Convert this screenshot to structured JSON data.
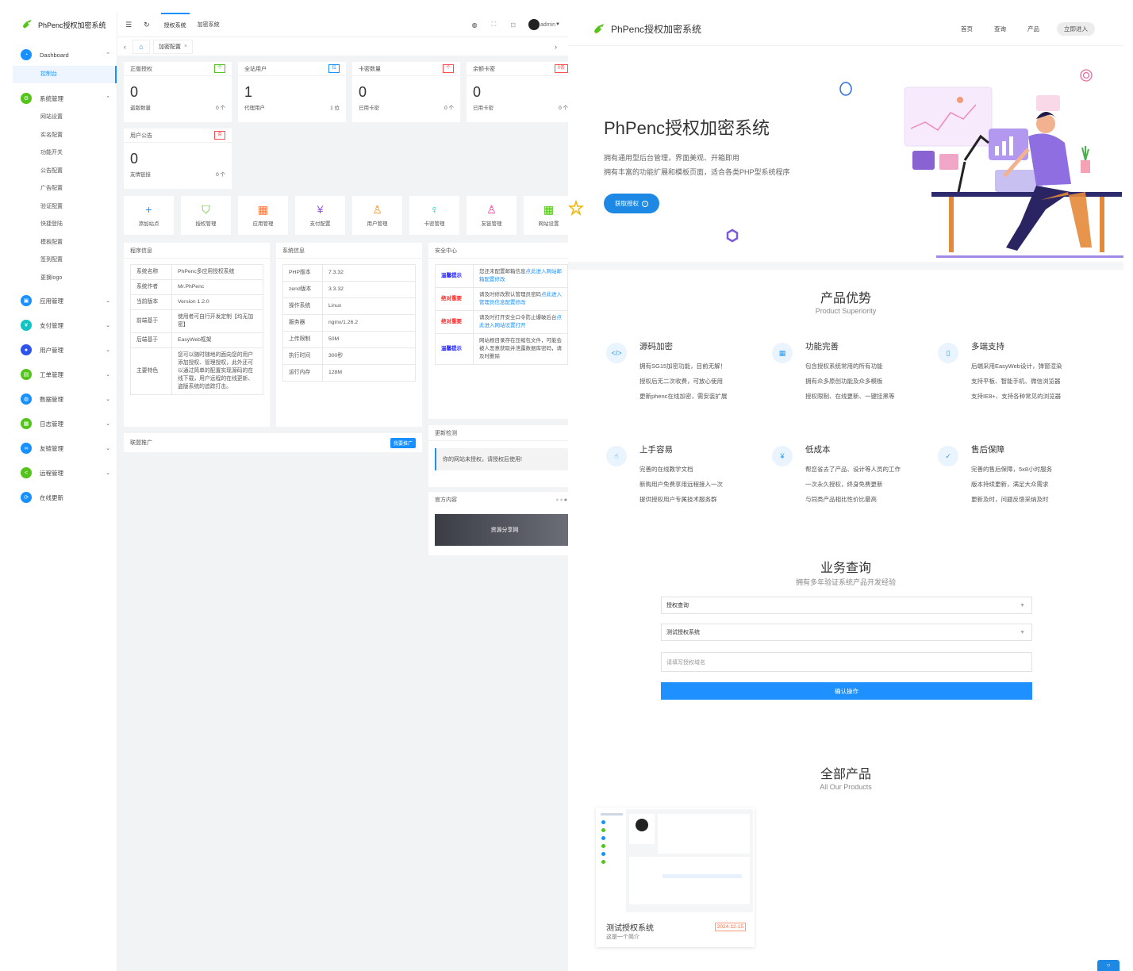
{
  "admin": {
    "brand": "PhPenc授权加密系统",
    "menu": [
      {
        "label": "Dashboard",
        "color": "#1890ff",
        "icon": "dashboard-icon",
        "glyph": "◔",
        "arrow": "⌃",
        "sub": [
          {
            "label": "控制台",
            "active": true
          }
        ]
      },
      {
        "label": "系统管理",
        "color": "#52c41a",
        "icon": "gear-icon",
        "glyph": "⚙",
        "arrow": "⌃",
        "sub": [
          {
            "label": "网站设置"
          },
          {
            "label": "实名配置"
          },
          {
            "label": "功能开关"
          },
          {
            "label": "公告配置"
          },
          {
            "label": "广告配置"
          },
          {
            "label": "验证配置"
          },
          {
            "label": "快捷登陆"
          },
          {
            "label": "模板配置"
          },
          {
            "label": "签到配置"
          },
          {
            "label": "更换logo"
          }
        ]
      },
      {
        "label": "应用管理",
        "color": "#1890ff",
        "icon": "app-icon",
        "glyph": "▣",
        "arrow": "⌄"
      },
      {
        "label": "支付管理",
        "color": "#13c2c2",
        "icon": "pay-icon",
        "glyph": "¥",
        "arrow": "⌄"
      },
      {
        "label": "用户管理",
        "color": "#2f54eb",
        "icon": "user-icon",
        "glyph": "●",
        "arrow": "⌄"
      },
      {
        "label": "工单管理",
        "color": "#52c41a",
        "icon": "ticket-icon",
        "glyph": "▤",
        "arrow": "⌄"
      },
      {
        "label": "数据管理",
        "color": "#1890ff",
        "icon": "data-icon",
        "glyph": "◍",
        "arrow": "⌄"
      },
      {
        "label": "日志管理",
        "color": "#52c41a",
        "icon": "log-icon",
        "glyph": "▦",
        "arrow": "⌄"
      },
      {
        "label": "友链管理",
        "color": "#1890ff",
        "icon": "link-icon",
        "glyph": "∞",
        "arrow": "⌄"
      },
      {
        "label": "远程管理",
        "color": "#52c41a",
        "icon": "remote-icon",
        "glyph": "<",
        "arrow": "⌄"
      },
      {
        "label": "在线更新",
        "color": "#1890ff",
        "icon": "update-icon",
        "glyph": "⟳",
        "arrow": ""
      }
    ],
    "topnav": {
      "items": [
        "授权系统",
        "加密系统"
      ],
      "user": "admin"
    },
    "tab": {
      "label": "加密配置",
      "close": "×"
    },
    "stats": [
      {
        "title": "正版授权",
        "tag": "个",
        "tagColor": "#52c41a",
        "value": "0",
        "foot": "盗版数量",
        "footVal": "0 个"
      },
      {
        "title": "全站用户",
        "tag": "位",
        "tagColor": "#1890ff",
        "value": "1",
        "foot": "代理用户",
        "footVal": "1 位"
      },
      {
        "title": "卡密数量",
        "tag": "个",
        "tagColor": "#ff4d4f",
        "value": "0",
        "foot": "已用卡密",
        "footVal": "0 个"
      },
      {
        "title": "余额卡密",
        "tag": "0条",
        "tagColor": "#ff4d4f",
        "value": "0",
        "foot": "已用卡密",
        "footVal": "0 个"
      },
      {
        "title": "用户公告",
        "tag": "条",
        "tagColor": "#ff4d4f",
        "value": "0",
        "foot": "友情链接",
        "footVal": "0 个"
      }
    ],
    "quick": [
      {
        "label": "添加站点",
        "icon": "plus-icon",
        "glyph": "+",
        "color": "#1890ff"
      },
      {
        "label": "授权管理",
        "icon": "shield-check-icon",
        "glyph": "⛉",
        "color": "#52c41a"
      },
      {
        "label": "应用管理",
        "icon": "apps-icon",
        "glyph": "▦",
        "color": "#ff7a45"
      },
      {
        "label": "支付配置",
        "icon": "yen-icon",
        "glyph": "¥",
        "color": "#9254de"
      },
      {
        "label": "用户管理",
        "icon": "person-icon",
        "glyph": "♙",
        "color": "#fa8c16"
      },
      {
        "label": "卡密管理",
        "icon": "key-icon",
        "glyph": "♀",
        "color": "#13c2c2"
      },
      {
        "label": "友链管理",
        "icon": "friends-icon",
        "glyph": "♙",
        "color": "#eb2f96"
      },
      {
        "label": "网站设置",
        "icon": "windows-icon",
        "glyph": "▦",
        "color": "#52c41a"
      }
    ],
    "program": {
      "title": "程序信息",
      "rows": [
        {
          "k": "系统名称",
          "v": "PhPenc多应用授权系统"
        },
        {
          "k": "系统作者",
          "v": "Mr.PhPenc"
        },
        {
          "k": "当前版本",
          "v": "Version 1.2.0"
        },
        {
          "k": "前端基于",
          "v": "使用者可自行开发定制【均无加密】"
        },
        {
          "k": "后端基于",
          "v": "EasyWeb框架"
        },
        {
          "k": "主要特色",
          "v": "您可以随时随地的面向您的用户添加授权、管理授权，此外还可以通过简单的配置实现源码的在线下载，用户远程的在线更新、盗版系统的追踪打击。"
        }
      ]
    },
    "sysinfo": {
      "title": "系统信息",
      "rows": [
        {
          "k": "PHP版本",
          "v": "7.3.32"
        },
        {
          "k": "zend版本",
          "v": "3.3.32"
        },
        {
          "k": "操作系统",
          "v": "Linux"
        },
        {
          "k": "服务器",
          "v": "nginx/1.26.2"
        },
        {
          "k": "上传限制",
          "v": "50M"
        },
        {
          "k": "执行时间",
          "v": "300秒"
        },
        {
          "k": "运行内存",
          "v": "128M"
        }
      ]
    },
    "security": {
      "title": "安全中心",
      "rows": [
        {
          "tag": "温馨提示",
          "tagColor": "#1a1aff",
          "text": "您还未配置邮箱信息",
          "link": "点此进入网站邮箱配置修改"
        },
        {
          "tag": "绝对重要",
          "tagColor": "#ff2222",
          "text": "请及时修改默认管理员密码",
          "link": "点此进入管理员信息配置修改"
        },
        {
          "tag": "绝对重要",
          "tagColor": "#ff2222",
          "text": "请及时打开安全口令防止爆破后台",
          "link": "点此进入网站设置打开"
        },
        {
          "tag": "温馨提示",
          "tagColor": "#1a1aff",
          "text": "网站根目录存在压缩包文件，可能会被人恶意获取并泄露数据库密码，请及时删除",
          "link": ""
        }
      ]
    },
    "promo": {
      "title": "联盟推广",
      "button": "我要推广"
    },
    "update": {
      "title": "更新检测",
      "text": "你的网站未授权，请授权后使用!"
    },
    "official": {
      "title": "官方内容",
      "banner": "资源分享网"
    }
  },
  "landing": {
    "brand": "PhPenc授权加密系统",
    "nav": [
      "首页",
      "查询",
      "产品"
    ],
    "navButton": "立即进入",
    "hero": {
      "title": "PhPenc授权加密系统",
      "line1": "拥有通用型后台管理，界面美观、开箱即用",
      "line2": "拥有丰富的功能扩展和模板页面，适合各类PHP型系统程序",
      "button": "获取授权"
    },
    "adv": {
      "title": "产品优势",
      "sub": "Product Superiority"
    },
    "features": [
      {
        "title": "源码加密",
        "icon": "code-icon",
        "glyph": "</>",
        "lines": [
          "拥有SG15加密功能，目前无解！",
          "授权后无二次收费，可放心使用",
          "更新phenc在线加密，需安装扩展"
        ]
      },
      {
        "title": "功能完善",
        "icon": "grid-plus-icon",
        "glyph": "▦",
        "lines": [
          "包含授权系统常用的所有功能",
          "拥有众多原创功能及众多模板",
          "授权限制、在线更新、一键挂黑等"
        ]
      },
      {
        "title": "多端支持",
        "icon": "tablet-icon",
        "glyph": "▯",
        "lines": [
          "后端采用EasyWeb设计，弹窗渲染",
          "支持平板、智能手机、微信浏览器",
          "支持IE8+、支持各种常见的浏览器"
        ]
      },
      {
        "title": "上手容易",
        "icon": "thumb-icon",
        "glyph": "☝",
        "lines": [
          "完善的在线教学文档",
          "新购用户免费享用远程接入一次",
          "提供授权用户专属技术服务群"
        ]
      },
      {
        "title": "低成本",
        "icon": "yen-circle-icon",
        "glyph": "¥",
        "lines": [
          "帮您省去了产品、设计等人员的工作",
          "一次永久授权，终身免费更新",
          "与同类产品相比性价比最高"
        ]
      },
      {
        "title": "售后保障",
        "icon": "shield-icon",
        "glyph": "✓",
        "lines": [
          "完善的售后保障，5x8小时服务",
          "版本持续更新，满足大众需求",
          "更新及时，问题反馈采纳及时"
        ]
      }
    ],
    "query": {
      "title": "业务查询",
      "sub": "拥有多年验证系统产品开发经验",
      "select1": "授权查询",
      "select2": "测试授权系统",
      "placeholder": "请填写授权域名",
      "button": "确认操作"
    },
    "products": {
      "title": "全部产品",
      "sub": "All Our Products",
      "item": {
        "name": "测试授权系统",
        "date": "2024-12-15",
        "desc": "这是一个简介"
      }
    }
  }
}
